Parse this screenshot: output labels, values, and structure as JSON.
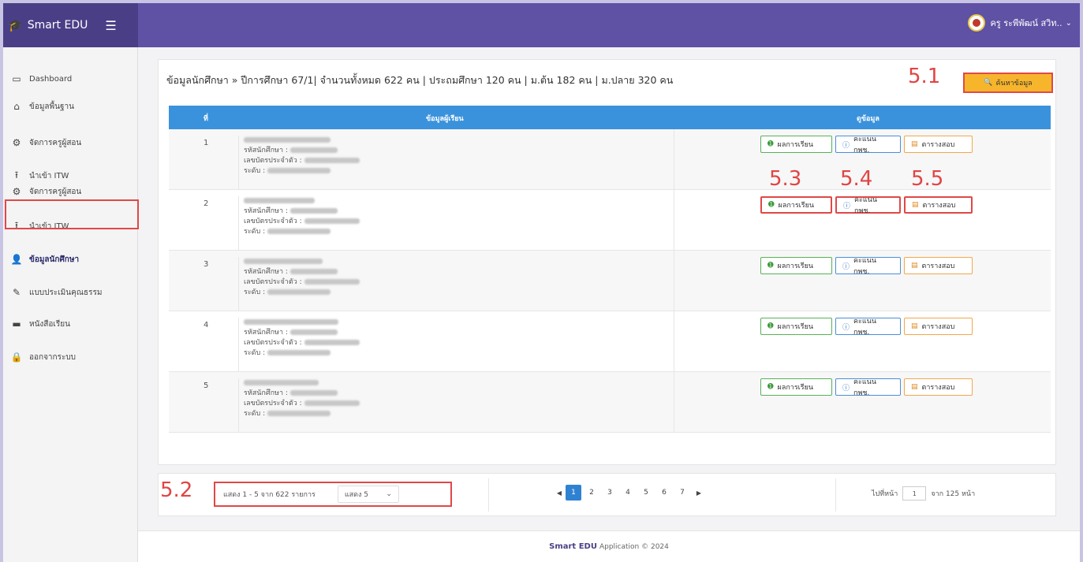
{
  "brand": {
    "name": "Smart EDU"
  },
  "user": {
    "name": "ครู ระพีพัฒน์ สวิท.."
  },
  "sidebar": {
    "items": [
      {
        "label": "Dashboard"
      },
      {
        "label": "ข้อมูลพื้นฐาน"
      },
      {
        "label": "จัดการครูผู้สอน"
      },
      {
        "label": "นำเข้า ITW"
      },
      {
        "label": "จัดการครูผู้สอน"
      },
      {
        "label": "นำเข้า ITW"
      },
      {
        "label": "ข้อมูลนักศึกษา"
      },
      {
        "label": "แบบประเมินคุณธรรม"
      },
      {
        "label": "หนังสือเรียน"
      },
      {
        "label": "ออกจากระบบ"
      }
    ]
  },
  "main": {
    "title": "ข้อมูลนักศึกษา » ปีการศึกษา 67/1| จำนวนทั้งหมด 622 คน | ประถมศึกษา 120 คน | ม.ต้น 182 คน | ม.ปลาย 320 คน",
    "search_label": "ค้นหาข้อมูล",
    "table": {
      "headers": {
        "num": "ที่",
        "info": "ข้อมูลผู้เรียน",
        "view": "ดูข้อมูล"
      },
      "field_labels": {
        "id": "รหัสนักศึกษา :",
        "card": "เลขบัตรประจำตัว :",
        "level": "ระดับ :"
      },
      "rows": [
        {
          "num": "1"
        },
        {
          "num": "2"
        },
        {
          "num": "3"
        },
        {
          "num": "4"
        },
        {
          "num": "5"
        }
      ],
      "actions": {
        "result": "ผลการเรียน",
        "score": "คะแนน กพช.",
        "exam": "ตารางสอบ"
      }
    }
  },
  "labels": {
    "l51": "5.1",
    "l52": "5.2",
    "l53": "5.3",
    "l54": "5.4",
    "l55": "5.5"
  },
  "pager": {
    "showing": "แสดง 1 - 5 จาก 622 รายการ",
    "per_page": "แสดง 5",
    "pages": [
      "1",
      "2",
      "3",
      "4",
      "5",
      "6",
      "7"
    ],
    "current_page": "1",
    "goto_label": "ไปที่หน้า",
    "goto_value": "1",
    "total_label": "จาก 125 หน้า"
  },
  "footer": {
    "brand": "Smart EDU",
    "text": "Application © 2024"
  }
}
